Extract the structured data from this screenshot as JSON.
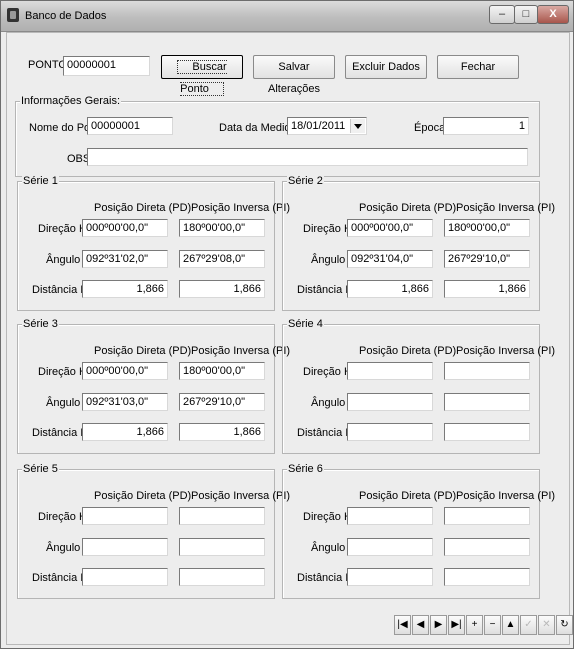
{
  "window": {
    "title": "Banco de Dados",
    "minimize": "‒",
    "maximize": "□",
    "close": "X"
  },
  "ponto": {
    "label": "PONTO",
    "value": "00000001"
  },
  "buttons": {
    "buscar": "Buscar Ponto",
    "salvar": "Salvar Alterações",
    "excluir": "Excluir Dados",
    "fechar": "Fechar"
  },
  "info": {
    "title": "Informações Gerais:",
    "nome_label": "Nome do Ponto:",
    "nome_value": "00000001",
    "data_label": "Data da Medida:",
    "data_value": "18/01/2011",
    "epoca_label": "Época",
    "epoca_value": "1",
    "obs_label": "OBS:",
    "obs_value": ""
  },
  "series_headers": {
    "pd": "Posição Direta (PD)",
    "pi": "Posição Inversa (PI)",
    "hz": "Direção Hz",
    "z": "Ângulo Z",
    "dist": "Distância Inc."
  },
  "series": [
    {
      "title": "Série 1",
      "hz_pd": "000º00'00,0\"",
      "hz_pi": "180º00'00,0\"",
      "z_pd": "092º31'02,0\"",
      "z_pi": "267º29'08,0\"",
      "dist_pd": "1,866",
      "dist_pi": "1,866"
    },
    {
      "title": "Série 2",
      "hz_pd": "000º00'00,0\"",
      "hz_pi": "180º00'00,0\"",
      "z_pd": "092º31'04,0\"",
      "z_pi": "267º29'10,0\"",
      "dist_pd": "1,866",
      "dist_pi": "1,866"
    },
    {
      "title": "Série 3",
      "hz_pd": "000º00'00,0\"",
      "hz_pi": "180º00'00,0\"",
      "z_pd": "092º31'03,0\"",
      "z_pi": "267º29'10,0\"",
      "dist_pd": "1,866",
      "dist_pi": "1,866"
    },
    {
      "title": "Série 4",
      "hz_pd": "",
      "hz_pi": "",
      "z_pd": "",
      "z_pi": "",
      "dist_pd": "",
      "dist_pi": ""
    },
    {
      "title": "Série 5",
      "hz_pd": "",
      "hz_pi": "",
      "z_pd": "",
      "z_pi": "",
      "dist_pd": "",
      "dist_pi": ""
    },
    {
      "title": "Série 6",
      "hz_pd": "",
      "hz_pi": "",
      "z_pd": "",
      "z_pi": "",
      "dist_pd": "",
      "dist_pi": ""
    }
  ],
  "navigator": [
    {
      "name": "first-record-icon",
      "glyph": "|◀",
      "enabled": true
    },
    {
      "name": "prior-record-icon",
      "glyph": "◀",
      "enabled": true
    },
    {
      "name": "next-record-icon",
      "glyph": "▶",
      "enabled": true
    },
    {
      "name": "last-record-icon",
      "glyph": "▶|",
      "enabled": true
    },
    {
      "name": "insert-record-icon",
      "glyph": "+",
      "enabled": true
    },
    {
      "name": "delete-record-icon",
      "glyph": "−",
      "enabled": true
    },
    {
      "name": "edit-record-icon",
      "glyph": "▲",
      "enabled": true
    },
    {
      "name": "post-record-icon",
      "glyph": "✓",
      "enabled": false
    },
    {
      "name": "cancel-record-icon",
      "glyph": "✕",
      "enabled": false
    },
    {
      "name": "refresh-record-icon",
      "glyph": "↻",
      "enabled": true
    }
  ]
}
